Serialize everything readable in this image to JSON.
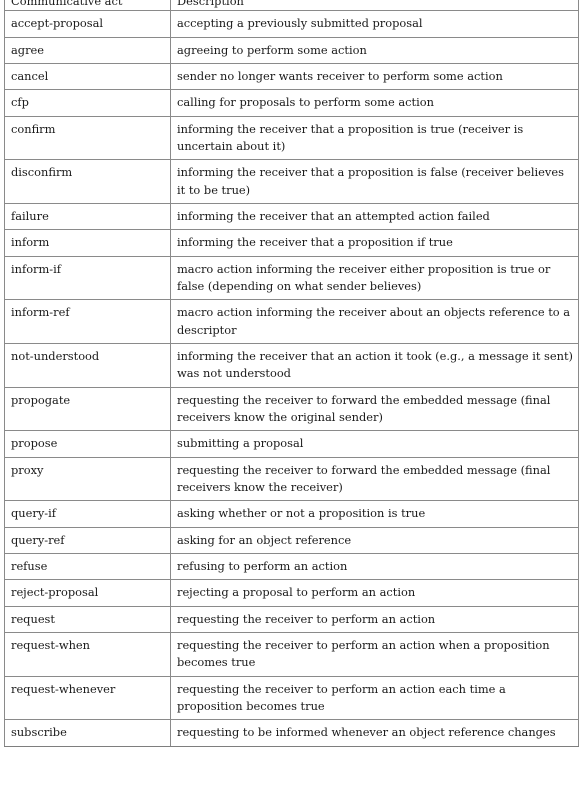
{
  "table": {
    "columns": [
      {
        "key": "act",
        "header": "Communicative act"
      },
      {
        "key": "desc",
        "header": "Description"
      }
    ],
    "rows": [
      {
        "act": "accept-proposal",
        "desc": "accepting a previously submitted proposal"
      },
      {
        "act": "agree",
        "desc": "agreeing to perform some action"
      },
      {
        "act": "cancel",
        "desc": "sender no longer wants receiver to perform some action"
      },
      {
        "act": "cfp",
        "desc": "calling for proposals to perform some action"
      },
      {
        "act": "confirm",
        "desc": "informing the receiver that a proposition is true (receiver is uncertain about it)"
      },
      {
        "act": "disconfirm",
        "desc": "informing the receiver that a proposition is false (receiver believes it to be true)"
      },
      {
        "act": "failure",
        "desc": "informing the receiver that an attempted action failed"
      },
      {
        "act": "inform",
        "desc": "informing the receiver that a proposition if true"
      },
      {
        "act": "inform-if",
        "desc": "macro action informing the receiver either proposition is true or false (depending on what sender believes)"
      },
      {
        "act": "inform-ref",
        "desc": "macro action informing the receiver about an objects reference to a descriptor"
      },
      {
        "act": "not-understood",
        "desc": "informing the receiver that an action it took (e.g., a message it sent) was not understood"
      },
      {
        "act": "propogate",
        "desc": "requesting the receiver to forward the embedded message (final receivers know the original sender)"
      },
      {
        "act": "propose",
        "desc": "submitting a proposal"
      },
      {
        "act": "proxy",
        "desc": "requesting the receiver to forward the embedded message (final receivers know the receiver)"
      },
      {
        "act": "query-if",
        "desc": "asking whether or not a proposition is true"
      },
      {
        "act": "query-ref",
        "desc": "asking for an object reference"
      },
      {
        "act": "refuse",
        "desc": "refusing to perform an action"
      },
      {
        "act": "reject-proposal",
        "desc": "rejecting a proposal to perform an action"
      },
      {
        "act": "request",
        "desc": "requesting the receiver to perform an action"
      },
      {
        "act": "request-when",
        "desc": "requesting the receiver to perform an action when a proposition becomes true"
      },
      {
        "act": "request-whenever",
        "desc": "requesting the receiver to perform an action each time a proposition becomes true"
      },
      {
        "act": "subscribe",
        "desc": "requesting to be informed whenever an object reference changes"
      }
    ]
  },
  "style": {
    "rule_color": "#8a8a8a",
    "text_color": "#1a1a1a",
    "background": "#ffffff"
  }
}
